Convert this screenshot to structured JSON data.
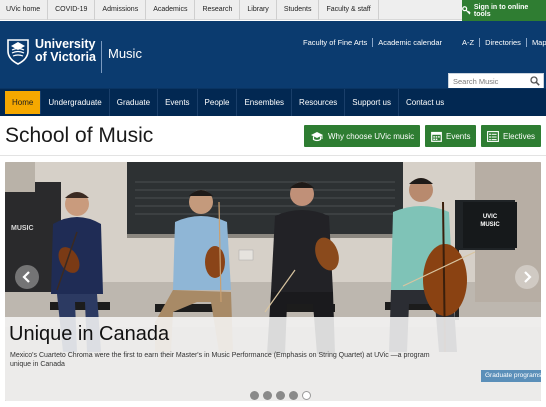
{
  "utility": {
    "links": [
      "UVic home",
      "COVID-19",
      "Admissions",
      "Academics",
      "Research",
      "Library",
      "Students",
      "Faculty & staff"
    ],
    "signin_label": "Sign in to online tools",
    "signin_icon": "key-icon"
  },
  "header": {
    "logo_line1": "University",
    "logo_line2": "of Victoria",
    "unit_name": "Music",
    "links": [
      "Faculty of Fine Arts",
      "Academic calendar",
      "A-Z",
      "Directories",
      "Maps"
    ],
    "search_placeholder": "Search Music",
    "colors": {
      "header_bg": "#0b3b6f",
      "nav_bg": "#022852",
      "accent": "#f5a800",
      "button_green": "#2e7d32"
    }
  },
  "nav": {
    "items": [
      "Home",
      "Undergraduate",
      "Graduate",
      "Events",
      "People",
      "Ensembles",
      "Resources",
      "Support us",
      "Contact us"
    ],
    "active": "Home"
  },
  "title_bar": {
    "page_title": "School of Music",
    "buttons": [
      {
        "label": "Why choose UVic music",
        "icon": "graduation-cap-icon"
      },
      {
        "label": "Events",
        "icon": "calendar-icon"
      },
      {
        "label": "Electives",
        "icon": "list-icon"
      }
    ]
  },
  "hero": {
    "title": "Unique in Canada",
    "text": "Mexico's Cuarteto Chroma were the first to earn their Master's in Music Performance (Emphasis on String Quartet) at UVic —a program unique in Canada",
    "button_label": "Graduate programs",
    "slide_count": 5,
    "active_slide": 5,
    "stand_label_line1": "UVIC",
    "stand_label_line2": "MUSIC",
    "image": "string-quartet-photo"
  }
}
